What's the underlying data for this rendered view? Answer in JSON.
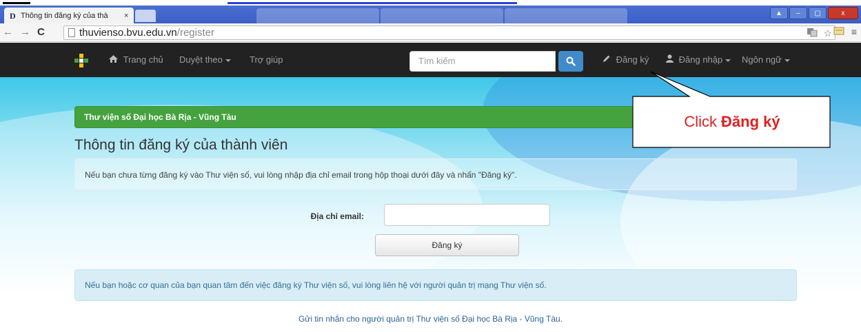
{
  "browser": {
    "tab_title": "Thông tin đăng ký của thà",
    "tab_close": "×",
    "favicon_letter": "D",
    "url_host": "thuvienso.bvu.edu.vn",
    "url_path": "/register",
    "window_buttons": [
      "▲",
      "–",
      "▢",
      "x"
    ]
  },
  "navbar": {
    "home": "Trang chủ",
    "browse": "Duyệt theo",
    "help": "Trợ giúp",
    "search_placeholder": "Tìm kiếm",
    "register": "Đăng ký",
    "login": "Đăng nhập",
    "language": "Ngôn ngữ"
  },
  "page": {
    "banner": "Thư viện số Đại học Bà Rịa - Vũng Tàu",
    "title": "Thông tin đăng ký của thành viên",
    "hint": "Nếu bạn chưa từng đăng ký vào Thư viện số, vui lòng nhập địa chỉ email trong hộp thoại dưới đây và nhấn \"Đăng ký\".",
    "email_label": "Địa chỉ email:",
    "email_value": "",
    "register_button": "Đăng ký",
    "info_alert": "Nếu bạn hoặc cơ quan của bạn quan tâm đến việc đăng ký Thư viện số, vui lòng liên hệ với người quản trị mạng Thư viện số.",
    "contact_link": "Gửi tin nhắn cho người quản trị Thư viện số Đại học Bà Rịa - Vũng Tàu."
  },
  "callout": {
    "prefix": "Click",
    "emphasis": "Đăng ký",
    "color": "#e02020"
  },
  "colors": {
    "navbar_bg": "#222222",
    "banner_green": "#44a33f",
    "search_button": "#428bca",
    "info_bg": "#d9edf7"
  }
}
